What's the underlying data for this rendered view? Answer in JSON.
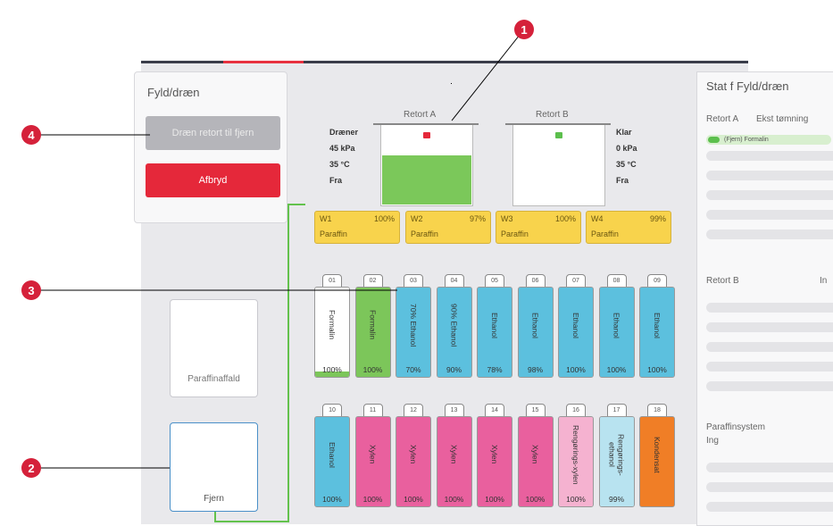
{
  "fill_drain": {
    "title": "Fyld/dræn",
    "drain_button": "Dræn retort til fjern",
    "abort_button": "Afbryd"
  },
  "waste": {
    "label": "Paraffinaffald"
  },
  "remote": {
    "label": "Fjern"
  },
  "retort_a": {
    "label": "Retort A",
    "state": "Dræner",
    "pressure": "45 kPa",
    "temp": "35 °C",
    "source": "Fra",
    "lock_color": "#e5283a",
    "fill_fraction": 0.62
  },
  "retort_b": {
    "label": "Retort B",
    "state": "Klar",
    "pressure": "0 kPa",
    "temp": "35 °C",
    "source": "Fra",
    "lock_color": "#5cbf4d"
  },
  "wax_baths": [
    {
      "id": "W1",
      "pct": "100%",
      "name": "Paraffin"
    },
    {
      "id": "W2",
      "pct": "97%",
      "name": "Paraffin"
    },
    {
      "id": "W3",
      "pct": "100%",
      "name": "Paraffin"
    },
    {
      "id": "W4",
      "pct": "99%",
      "name": "Paraffin"
    }
  ],
  "bottles_row1": [
    {
      "num": "01",
      "name": "Formalin",
      "pct": "100%",
      "color": "#ffffff",
      "fill": 0.06,
      "fill_color": "#7cc65a"
    },
    {
      "num": "02",
      "name": "Formalin",
      "pct": "100%",
      "color": "#7cc65a",
      "fill": 1.0,
      "fill_color": "#7cc65a"
    },
    {
      "num": "03",
      "name": "70% Ethanol",
      "pct": "70%",
      "color": "#5cc0de",
      "fill": 1.0,
      "fill_color": "#5cc0de"
    },
    {
      "num": "04",
      "name": "90% Ethanol",
      "pct": "90%",
      "color": "#5cc0de",
      "fill": 1.0,
      "fill_color": "#5cc0de"
    },
    {
      "num": "05",
      "name": "Ethanol",
      "pct": "78%",
      "color": "#5cc0de",
      "fill": 1.0,
      "fill_color": "#5cc0de"
    },
    {
      "num": "06",
      "name": "Ethanol",
      "pct": "98%",
      "color": "#5cc0de",
      "fill": 1.0,
      "fill_color": "#5cc0de"
    },
    {
      "num": "07",
      "name": "Ethanol",
      "pct": "100%",
      "color": "#5cc0de",
      "fill": 1.0,
      "fill_color": "#5cc0de"
    },
    {
      "num": "08",
      "name": "Ethanol",
      "pct": "100%",
      "color": "#5cc0de",
      "fill": 1.0,
      "fill_color": "#5cc0de"
    },
    {
      "num": "09",
      "name": "Ethanol",
      "pct": "100%",
      "color": "#5cc0de",
      "fill": 1.0,
      "fill_color": "#5cc0de"
    }
  ],
  "bottles_row2": [
    {
      "num": "10",
      "name": "Ethanol",
      "pct": "100%",
      "color": "#5cc0de",
      "fill": 1.0,
      "fill_color": "#5cc0de"
    },
    {
      "num": "11",
      "name": "Xylen",
      "pct": "100%",
      "color": "#e9609e",
      "fill": 1.0,
      "fill_color": "#e9609e"
    },
    {
      "num": "12",
      "name": "Xylen",
      "pct": "100%",
      "color": "#e9609e",
      "fill": 1.0,
      "fill_color": "#e9609e"
    },
    {
      "num": "13",
      "name": "Xylen",
      "pct": "100%",
      "color": "#e9609e",
      "fill": 1.0,
      "fill_color": "#e9609e"
    },
    {
      "num": "14",
      "name": "Xylen",
      "pct": "100%",
      "color": "#e9609e",
      "fill": 1.0,
      "fill_color": "#e9609e"
    },
    {
      "num": "15",
      "name": "Xylen",
      "pct": "100%",
      "color": "#e9609e",
      "fill": 1.0,
      "fill_color": "#e9609e"
    },
    {
      "num": "16",
      "name": "Rengørings-xylen",
      "pct": "100%",
      "color": "#f5b2d0",
      "fill": 1.0,
      "fill_color": "#f5b2d0"
    },
    {
      "num": "17",
      "name": "Rengørings-ethanol",
      "pct": "99%",
      "color": "#b8e3f0",
      "fill": 1.0,
      "fill_color": "#b8e3f0"
    },
    {
      "num": "18",
      "name": "Kondensat",
      "pct": "",
      "color": "#f07e26",
      "fill": 1.0,
      "fill_color": "#f07e26"
    }
  ],
  "status_panel": {
    "title": "Stat f Fyld/dræn",
    "retort_a_label": "Retort A",
    "retort_a_info": "Ekst tømning",
    "retort_a_pill": "(Fjern) Formalin",
    "retort_b_label": "Retort B",
    "retort_b_info": "In",
    "paraffin_label": "Paraffinsystem",
    "paraffin_info": "Ing"
  },
  "callouts": [
    "1",
    "2",
    "3",
    "4"
  ]
}
